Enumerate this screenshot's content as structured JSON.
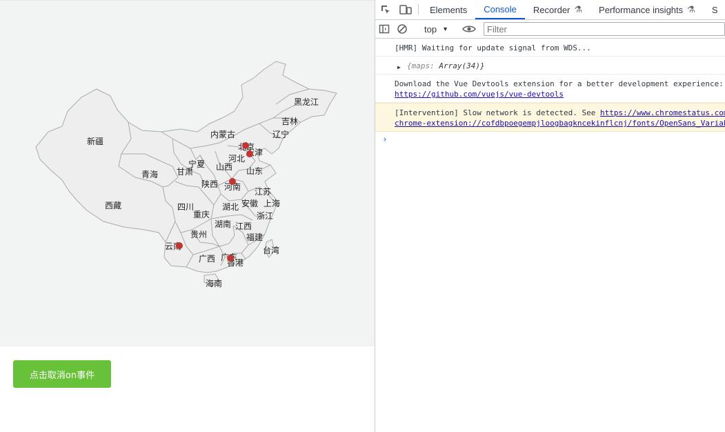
{
  "map": {
    "provinces": [
      {
        "name": "黑龙江"
      },
      {
        "name": "吉林"
      },
      {
        "name": "辽宁"
      },
      {
        "name": "内蒙古"
      },
      {
        "name": "新疆"
      },
      {
        "name": "北京"
      },
      {
        "name": "天津"
      },
      {
        "name": "河北"
      },
      {
        "name": "宁夏"
      },
      {
        "name": "甘肃"
      },
      {
        "name": "山西"
      },
      {
        "name": "山东"
      },
      {
        "name": "青海"
      },
      {
        "name": "陕西"
      },
      {
        "name": "河南"
      },
      {
        "name": "江苏"
      },
      {
        "name": "安徽"
      },
      {
        "name": "上海"
      },
      {
        "name": "西藏"
      },
      {
        "name": "四川"
      },
      {
        "name": "湖北"
      },
      {
        "name": "重庆"
      },
      {
        "name": "浙江"
      },
      {
        "name": "湖南"
      },
      {
        "name": "江西"
      },
      {
        "name": "贵州"
      },
      {
        "name": "福建"
      },
      {
        "name": "云南"
      },
      {
        "name": "台湾"
      },
      {
        "name": "广西"
      },
      {
        "name": "广东"
      },
      {
        "name": "香港"
      },
      {
        "name": "海南"
      }
    ],
    "marker_color": "#c23531",
    "fill_color": "#eeeeee",
    "stroke_color": "#aaaaaa"
  },
  "button": {
    "label": "点击取消on事件",
    "color": "#67c23a"
  },
  "devtools": {
    "tabs": [
      {
        "label": "Elements"
      },
      {
        "label": "Console"
      },
      {
        "label": "Recorder"
      },
      {
        "label": "Performance insights"
      },
      {
        "label": "S"
      }
    ],
    "active_tab": "Console",
    "context": "top",
    "filter_placeholder": "Filter",
    "messages": {
      "hmr": "[HMR] Waiting for update signal from WDS...",
      "obj_key": "{maps:",
      "obj_val": "Array(34)}",
      "vue_text": "Download the Vue Devtools extension for a better development experience:",
      "vue_link": "https://github.com/vuejs/vue-devtools",
      "warn_text": "[Intervention] Slow network is detected. See ",
      "warn_link": "https://www.chromestatus.com/feature/",
      "warn_link2": "chrome-extension://cofdbpoegempjloogbagkncekinflcnj/fonts/OpenSans_VariableFont_"
    },
    "prompt": "›"
  }
}
